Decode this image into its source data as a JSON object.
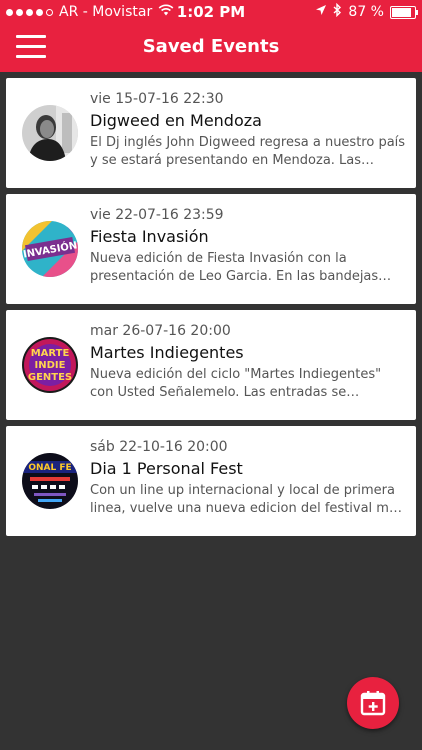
{
  "status_bar": {
    "carrier": "AR - Movistar",
    "time": "1:02 PM",
    "battery": "87 %",
    "battery_level": 0.87
  },
  "nav": {
    "title": "Saved Events"
  },
  "events": [
    {
      "date": "vie 15-07-16 22:30",
      "title": "Digweed en Mendoza",
      "description": "El Dj inglés John Digweed regresa a nuestro país y se estará presentando en Mendoza. Las entradas ya están a la venta."
    },
    {
      "date": "vie 22-07-16 23:59",
      "title": "Fiesta Invasión",
      "description": "Nueva edición de Fiesta Invasión con la presentación de Leo Garcia. En las bandejas estarán los djs residentes."
    },
    {
      "date": "mar 26-07-16 20:00",
      "title": "Martes Indiegentes",
      "description": "Nueva edición del ciclo \"Martes Indiegentes\" con Usted Señalemelo. Las entradas se consiguen en boletería."
    },
    {
      "date": "sáb 22-10-16 20:00",
      "title": "Dia 1 Personal Fest",
      "description": "Con un line up internacional y local de primera linea, vuelve una nueva edicion del festival más esperado."
    }
  ],
  "avatar_logos": {
    "invasion": "INVASIÓN",
    "martes": [
      "MARTE",
      "INDIE",
      "GENTES"
    ],
    "personal_fest": "ONAL FE"
  }
}
